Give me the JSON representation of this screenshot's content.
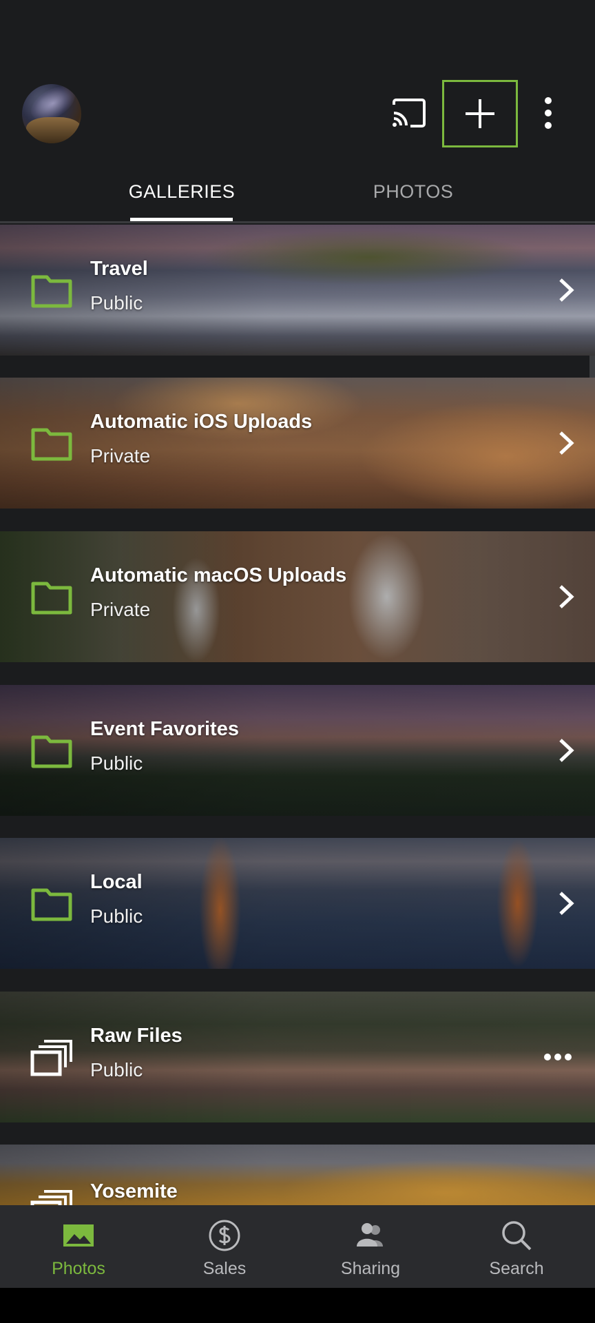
{
  "tabs": {
    "galleries": "GALLERIES",
    "photos": "PHOTOS"
  },
  "galleries": [
    {
      "title": "Travel",
      "visibility": "Public",
      "icon": "folder-icon",
      "action": "chevron-right-icon"
    },
    {
      "title": "Automatic iOS Uploads",
      "visibility": "Private",
      "icon": "folder-icon",
      "action": "chevron-right-icon"
    },
    {
      "title": "Automatic macOS Uploads",
      "visibility": "Private",
      "icon": "folder-icon",
      "action": "chevron-right-icon"
    },
    {
      "title": "Event Favorites",
      "visibility": "Public",
      "icon": "folder-icon",
      "action": "chevron-right-icon"
    },
    {
      "title": "Local",
      "visibility": "Public",
      "icon": "folder-icon",
      "action": "chevron-right-icon"
    },
    {
      "title": "Raw Files",
      "visibility": "Public",
      "icon": "album-stack-icon",
      "action": "more-horizontal-icon"
    },
    {
      "title": "Yosemite",
      "visibility": "",
      "icon": "album-stack-icon",
      "action": ""
    }
  ],
  "bottom_nav": {
    "photos": "Photos",
    "sales": "Sales",
    "sharing": "Sharing",
    "search": "Search"
  },
  "colors": {
    "accent": "#7cb93e",
    "background": "#1b1c1e",
    "nav_background": "#2a2b2e",
    "inactive_text": "#b9babd"
  }
}
